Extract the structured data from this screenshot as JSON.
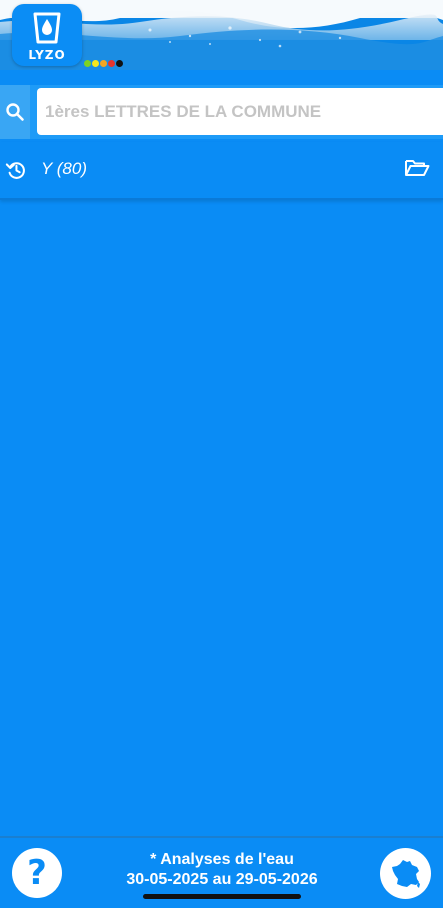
{
  "header": {
    "logo_text": "LYZO",
    "quality_dots": [
      "#7ed321",
      "#f8e71c",
      "#f5a623",
      "#e8342b",
      "#111111"
    ]
  },
  "search": {
    "placeholder": "1ères LETTRES DE LA COMMUNE",
    "value": "",
    "icon": "search-icon"
  },
  "history": {
    "icon": "history-icon",
    "label": "Y (80)",
    "folder_icon": "folder-open-icon"
  },
  "footer": {
    "help_label": "?",
    "analysis_line1": "* Analyses de l'eau",
    "analysis_line2": "30-05-2025 au 29-05-2026",
    "map_icon": "france-map-icon"
  },
  "colors": {
    "background": "#0a8cf5",
    "accent": "#ffffff"
  }
}
